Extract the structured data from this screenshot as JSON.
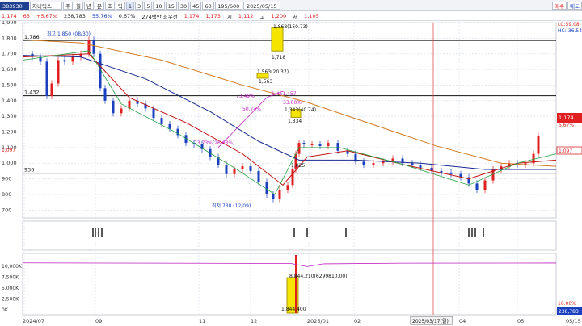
{
  "toolbar": {
    "code": "383930",
    "name": "지니틱스",
    "periods": [
      "주",
      "월",
      "년",
      "분",
      "초",
      "틱"
    ],
    "intervals": [
      "1",
      "3",
      "5",
      "10",
      "15",
      "30",
      "45",
      "60"
    ],
    "count": "195/600",
    "date": "2025/05/15",
    "buy": "매수",
    "sell": "매도"
  },
  "info": {
    "price": "1,174",
    "change": "63",
    "change_pct": "+5.67%",
    "volume": "238,783",
    "turnover": "55.76%",
    "ratio": "0.67%",
    "amount": "274백만 최우선",
    "best_ask": "1,174",
    "best_bid": "1,173",
    "open_label": "시",
    "open": "1,112",
    "high_label": "고",
    "high": "1,200",
    "low_label": "저",
    "low": "1,105"
  },
  "chart_data": {
    "type": "line",
    "series_note": "",
    "x_ticks": [
      "2024/07",
      "09",
      "11",
      "12",
      "2025/01",
      "02",
      "04",
      "05",
      "05/15"
    ],
    "y_ticks": [
      "1,900",
      "1,800",
      "1,700",
      "1,600",
      "1,500",
      "1,400",
      "1,300",
      "1,200",
      "1,100",
      "1,000",
      "900",
      "800",
      "700"
    ],
    "ylim": [
      650,
      1900
    ],
    "price_axis_labels": [
      "1,786",
      "1,432",
      "936"
    ],
    "right_labels": [
      "1,174",
      "5.67%",
      "1,097",
      "1,097"
    ],
    "hlines": [
      1786,
      1432,
      1097,
      936
    ],
    "annotations": [
      {
        "text": "최고 1,850 (08/30)",
        "color": "#1a3fbf"
      },
      {
        "text": "1,868(150.73)",
        "color": "#111"
      },
      {
        "text": "1,718",
        "color": "#111"
      },
      {
        "text": "1,563(20.37)",
        "color": "#111"
      },
      {
        "text": "1,563",
        "color": "#111"
      },
      {
        "text": "73.49%",
        "color": "#c020c0"
      },
      {
        "text": "1,451,457",
        "color": "#c020c0"
      },
      {
        "text": "50.74%",
        "color": "#c020c0"
      },
      {
        "text": "33.00%",
        "color": "#c020c0"
      },
      {
        "text": "1,343(40.74)",
        "color": "#111"
      },
      {
        "text": "1,334",
        "color": "#111"
      },
      {
        "text": "73.73%(26.63%)",
        "color": "#c020c0"
      },
      {
        "text": "1,025",
        "color": "#111"
      },
      {
        "text": "최저 738 (12/09)",
        "color": "#1a3fbf"
      }
    ],
    "ma_labels": [
      "LC:59.08",
      "HC:-36.54"
    ],
    "volume_axis": [
      "10,000K",
      "7,500K",
      "5,000K",
      "2,500K",
      "0K"
    ],
    "volume_labels": [
      "8,844,210(6299810.00)",
      "1,844,400"
    ],
    "volume_right": [
      "10.00%",
      "238,783"
    ],
    "crosshair_label": "2025/03/17(월)",
    "bottom_axis_labels": [
      "2024/07",
      "09",
      "11",
      "12",
      "2025/01",
      "02",
      "04",
      "05",
      "05/15"
    ],
    "grid": true
  }
}
